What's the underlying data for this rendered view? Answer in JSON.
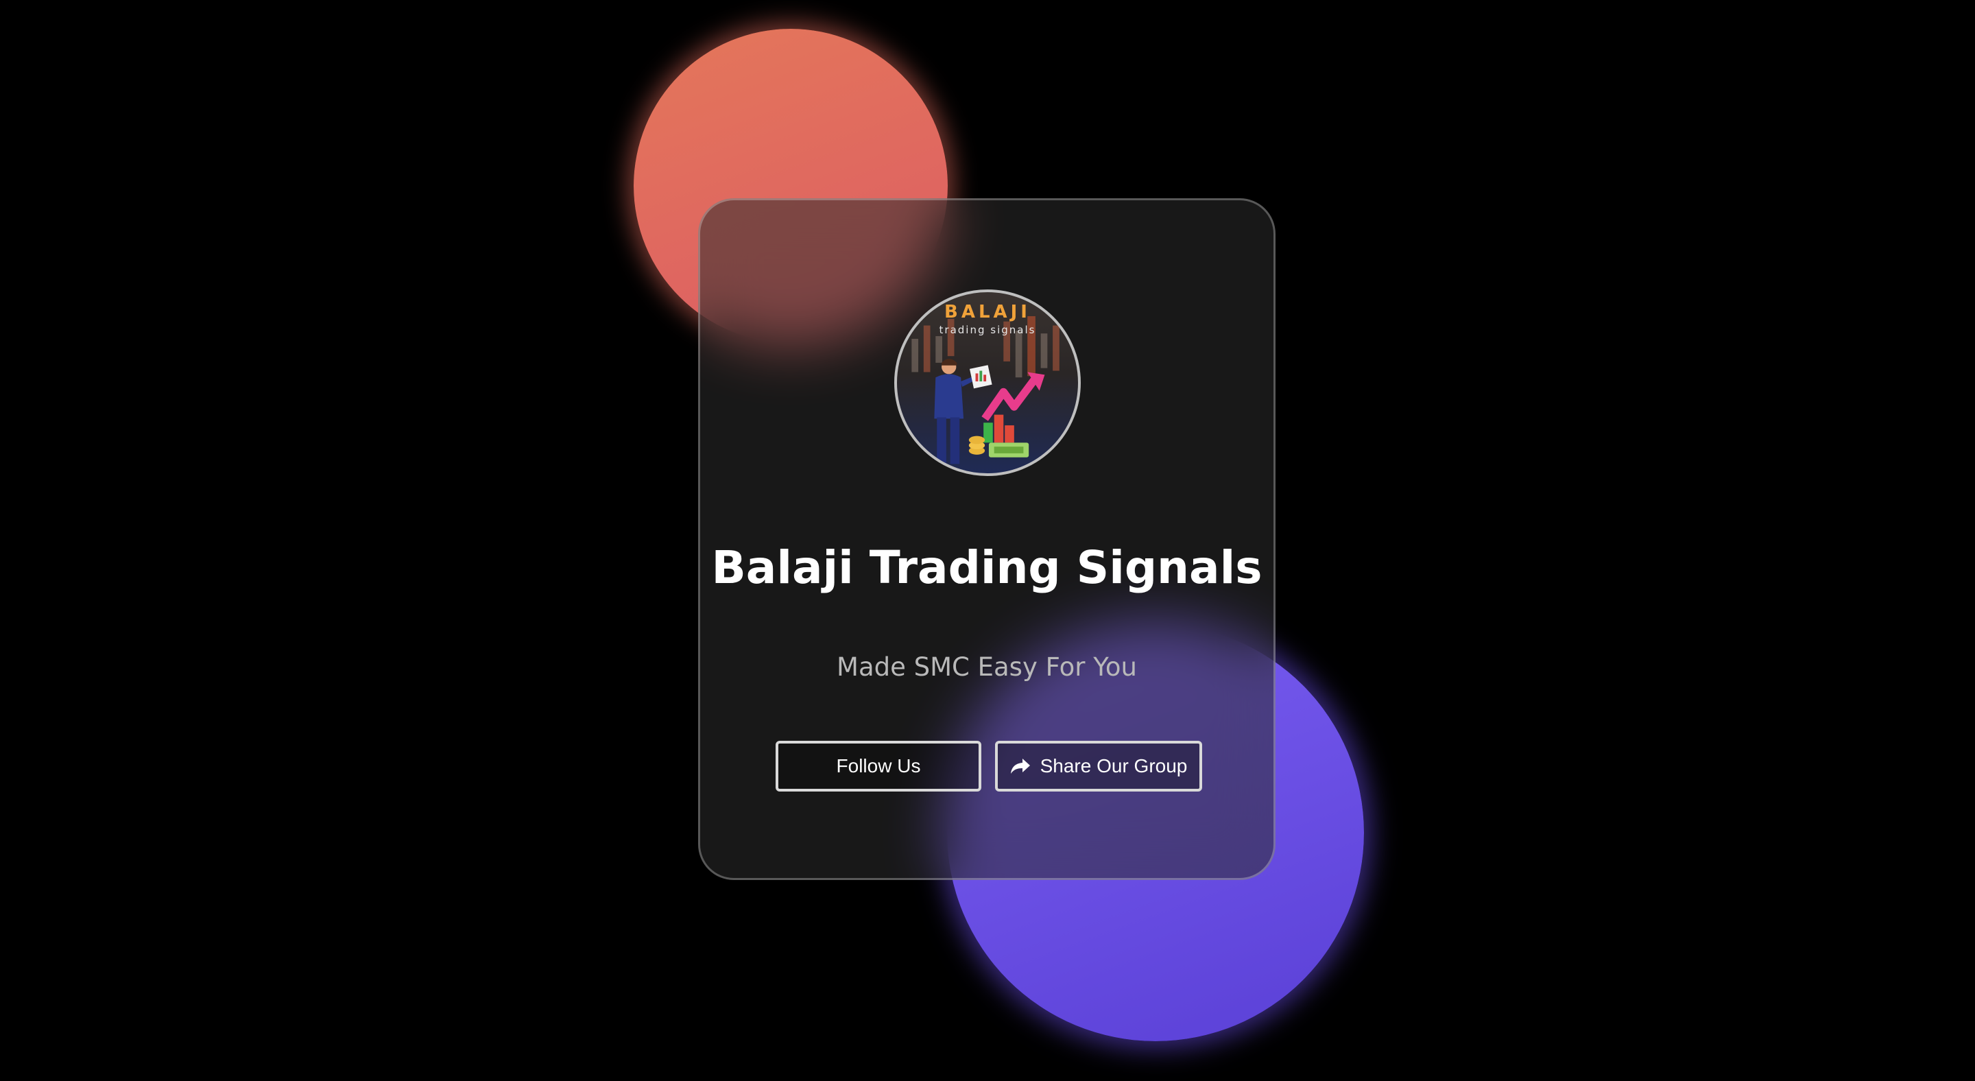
{
  "page": {
    "background_color": "#000000"
  },
  "decor": {
    "orange_circle_color": "#e06a5e",
    "purple_circle_color": "#6a4fe6"
  },
  "profile": {
    "logo": {
      "brand": "BALAJI",
      "tagline": "trading signals",
      "icon": "businessman-chart-logo"
    },
    "title": "Balaji Trading Signals",
    "subtitle": "Made SMC Easy For You"
  },
  "actions": {
    "follow_label": "Follow Us",
    "share_label": "Share Our Group",
    "share_icon": "share-arrow-icon"
  }
}
